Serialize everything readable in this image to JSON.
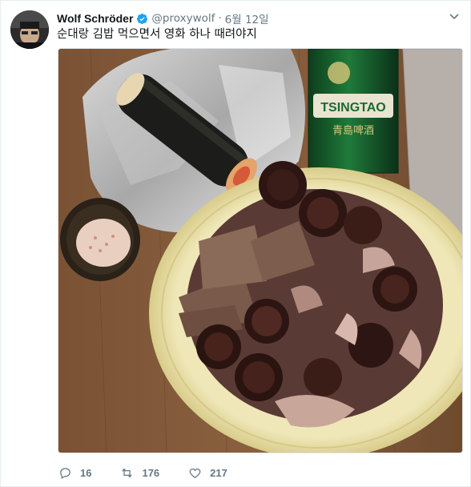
{
  "tweet": {
    "author": {
      "display_name": "Wolf Schröder",
      "handle": "@proxywolf",
      "verified": true,
      "avatar_icon": "avatar-photo"
    },
    "separator": "·",
    "date": "6월 12일",
    "text": "순대랑 김밥 먹으면서 영화 하나 때려야지",
    "media": {
      "description_icon": "photo",
      "can_label": "TSINGTAO",
      "can_label_cn": "青島啤酒"
    },
    "actions": {
      "reply_count": "16",
      "retweet_count": "176",
      "like_count": "217"
    }
  },
  "colors": {
    "accent": "#1da1f2",
    "muted": "#657786",
    "text": "#14171a"
  }
}
